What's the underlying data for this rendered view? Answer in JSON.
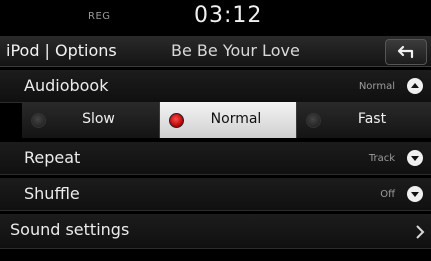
{
  "status": {
    "reg": "REG",
    "time": "03:12"
  },
  "header": {
    "title": "iPod | Options",
    "track": "Be Be Your Love",
    "back_icon": "back-arrow-icon"
  },
  "rows": {
    "audiobook": {
      "label": "Audiobook",
      "value": "Normal",
      "arrow_icon": "chevron-up-icon"
    },
    "repeat": {
      "label": "Repeat",
      "value": "Track",
      "arrow_icon": "chevron-down-icon"
    },
    "shuffle": {
      "label": "Shuffle",
      "value": "Off",
      "arrow_icon": "chevron-down-icon"
    },
    "sound": {
      "label": "Sound settings",
      "arrow_icon": "chevron-right-icon"
    }
  },
  "speed_options": [
    {
      "label": "Slow",
      "selected": false
    },
    {
      "label": "Normal",
      "selected": true
    },
    {
      "label": "Fast",
      "selected": false
    }
  ],
  "colors": {
    "selected_radio": "#e00000",
    "background": "#000000"
  }
}
